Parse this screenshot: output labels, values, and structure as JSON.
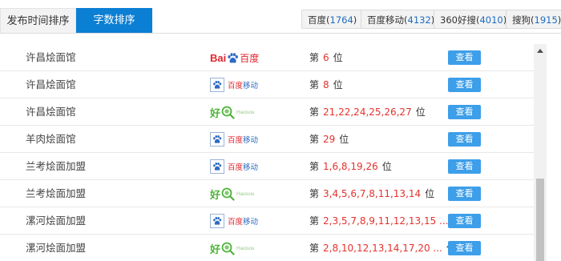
{
  "tabs": {
    "publish_time": "发布时间排序",
    "word_count": "字数排序"
  },
  "engines": [
    {
      "label": "百度",
      "count": "1764"
    },
    {
      "label": "百度移动",
      "count": "4132"
    },
    {
      "label": "360好搜",
      "count": "4010"
    },
    {
      "label": "搜狗",
      "count": "1915"
    }
  ],
  "rank_prefix": "第",
  "rank_suffix": "位",
  "view_label": "查看",
  "logo_text": {
    "baidu_bai": "Bai",
    "baidu_du": "百度",
    "bdmobile_a": "百度",
    "bdmobile_b": "移动",
    "haosou_hao": "好",
    "haosou_en": "Haosou"
  },
  "rows": [
    {
      "name": "许昌烩面馆",
      "engine": "baidu",
      "ranks": "6"
    },
    {
      "name": "许昌烩面馆",
      "engine": "baidu_mobile",
      "ranks": "8"
    },
    {
      "name": "许昌烩面馆",
      "engine": "haosou",
      "ranks": "21,22,24,25,26,27"
    },
    {
      "name": "羊肉烩面馆",
      "engine": "baidu_mobile",
      "ranks": "29"
    },
    {
      "name": "兰考烩面加盟",
      "engine": "baidu_mobile",
      "ranks": "1,6,8,19,26"
    },
    {
      "name": "兰考烩面加盟",
      "engine": "haosou",
      "ranks": "3,4,5,6,7,8,11,13,14"
    },
    {
      "name": "漯河烩面加盟",
      "engine": "baidu_mobile",
      "ranks": "2,3,5,7,8,9,11,12,13,15 ..."
    },
    {
      "name": "漯河烩面加盟",
      "engine": "haosou",
      "ranks": "2,8,10,12,13,14,17,20 ..."
    }
  ],
  "colors": {
    "active_tab": "#0b7fd4",
    "view_button": "#3d9ee9",
    "rank_number": "#e4322c",
    "engine_count": "#1c6cc0"
  }
}
